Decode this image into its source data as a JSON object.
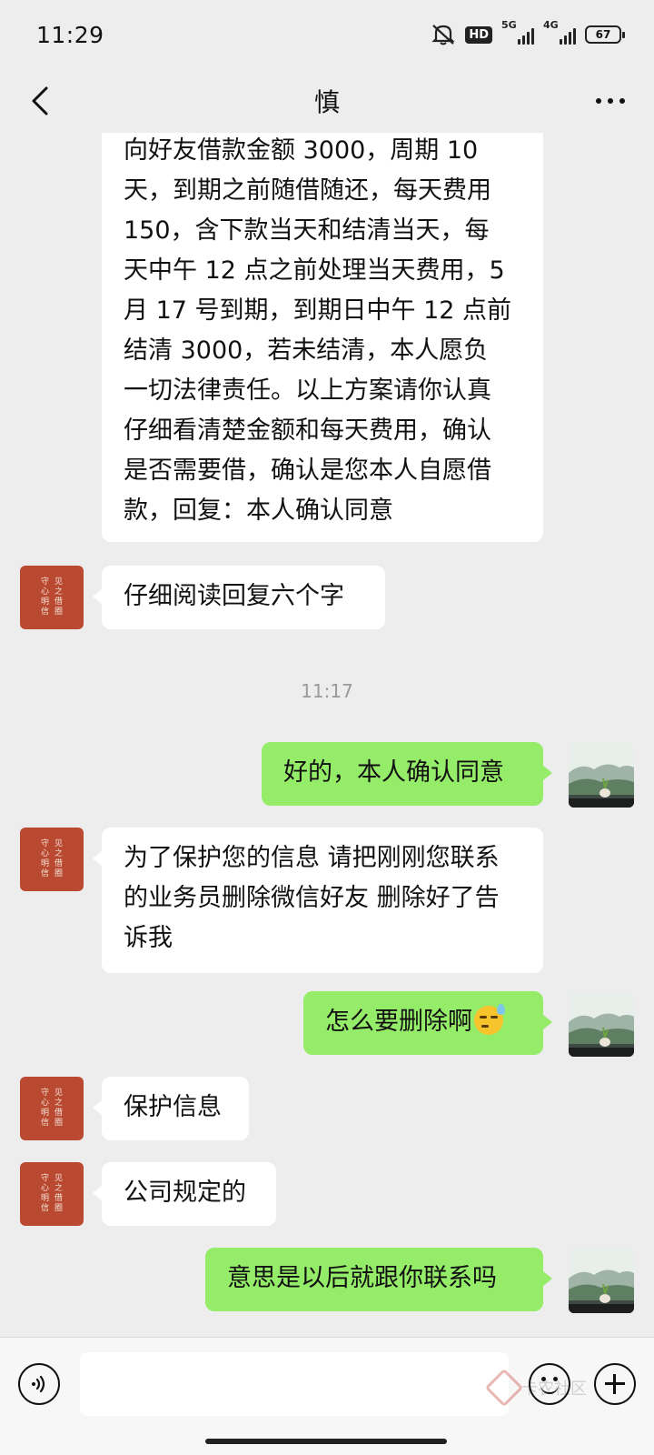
{
  "status_bar": {
    "time": "11:29",
    "hd_label": "HD",
    "network_1": "5G",
    "network_2": "4G",
    "battery": "67"
  },
  "header": {
    "title": "慎"
  },
  "messages": [
    {
      "direction": "incoming",
      "text": "向好友借款金额3000，周期10天，到期之前随借随还，每天费用150，含下款当天和结清当天，每天中午12点之前处理当天费用，5月17号到期，到期日中午12点前结清3000，若未结清，本人愿负一切法律责任。以上方案请你认真仔细看清楚金额和每天费用，确认是否需要借，确认是您本人自愿借款，回复：本人确认同意"
    },
    {
      "direction": "incoming",
      "text": "仔细阅读回复六个字"
    },
    {
      "direction": "outgoing",
      "text": "好的，本人确认同意"
    },
    {
      "direction": "incoming",
      "text": "为了保护您的信息 请把刚刚您联系的业务员删除微信好友 删除好了告诉我"
    },
    {
      "direction": "outgoing",
      "text": "怎么要删除啊",
      "emoji": "sweat-smile-emoji"
    },
    {
      "direction": "incoming",
      "text": "保护信息"
    },
    {
      "direction": "incoming",
      "text": "公司规定的"
    },
    {
      "direction": "outgoing",
      "text": "意思是以后就跟你联系吗"
    }
  ],
  "lines_msg0": [
    "向好友借款金额 3000，周期 10",
    "天，到期之前随借随还，每天费用",
    "150，含下款当天和结清当天，每",
    "天中午 12 点之前处理当天费用，5",
    "月 17 号到期，到期日中午 12 点前",
    "结清 3000，若未结清，本人愿负",
    "一切法律责任。以上方案请你认真",
    "仔细看清楚金额和每天费用，确认",
    "是否需要借，确认是您本人自愿借",
    "款，回复：本人确认同意"
  ],
  "lines_msg3": [
    "为了保护您的信息 请把刚刚您联系",
    "的业务员删除微信好友 删除好了告",
    "诉我"
  ],
  "timestamp": "11:17",
  "avatar_seal_text": [
    "见",
    "之",
    "借",
    "圈",
    "守",
    "心",
    "明",
    "信"
  ],
  "input": {
    "placeholder": ""
  },
  "watermark": "卡农社区",
  "colors": {
    "background": "#ededed",
    "incoming_bubble": "#ffffff",
    "outgoing_bubble": "#95ec69",
    "avatar_red": "#b94a31"
  }
}
